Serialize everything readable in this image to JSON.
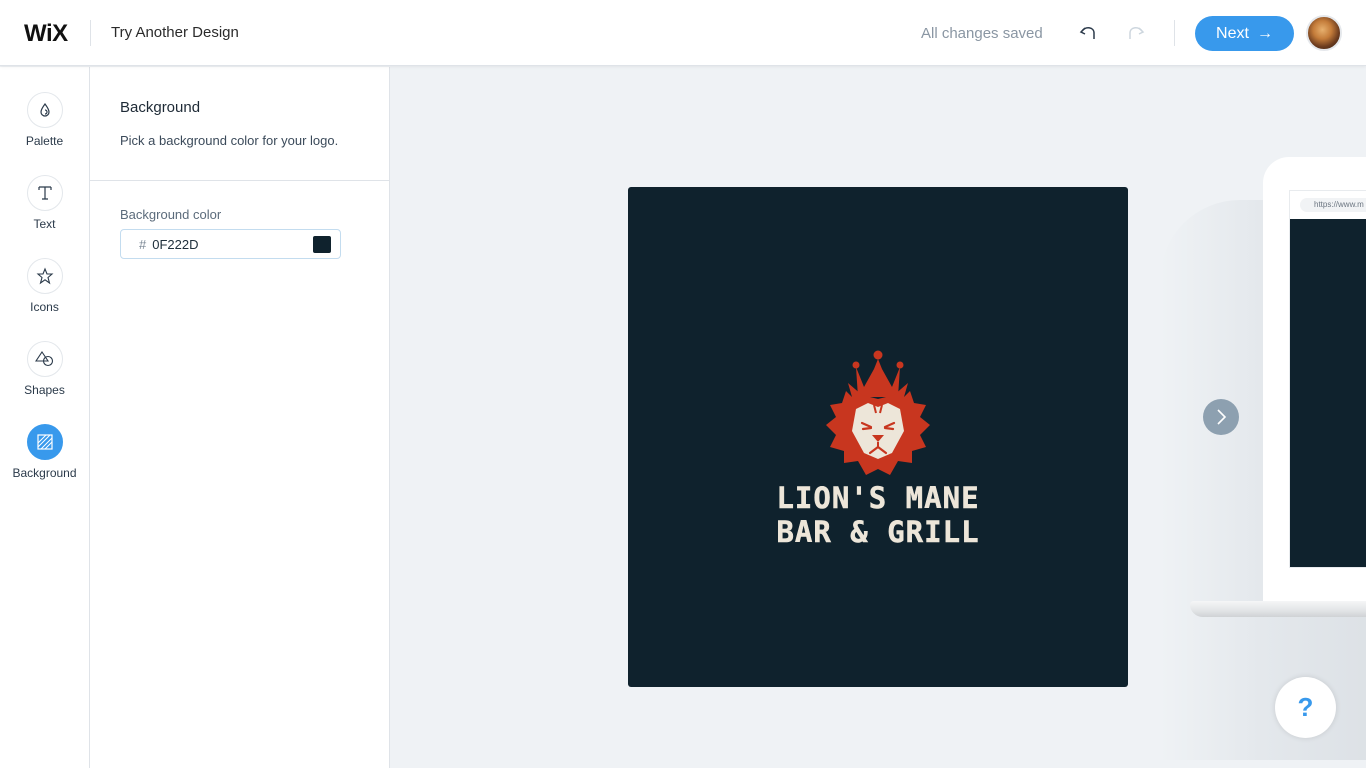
{
  "header": {
    "brand": "WiX",
    "title": "Try Another Design",
    "status": "All changes saved",
    "undo_icon": "undo-icon",
    "redo_icon": "redo-icon",
    "next_label": "Next",
    "next_arrow": "→"
  },
  "nav": {
    "items": [
      {
        "label": "Palette",
        "icon": "drop-icon",
        "active": false
      },
      {
        "label": "Text",
        "icon": "text-T-icon",
        "active": false
      },
      {
        "label": "Icons",
        "icon": "star-icon",
        "active": false
      },
      {
        "label": "Shapes",
        "icon": "shapes-icon",
        "active": false
      },
      {
        "label": "Background",
        "icon": "background-hatch-icon",
        "active": true
      }
    ]
  },
  "panel": {
    "title": "Background",
    "subtitle": "Pick a background color for your logo.",
    "field_label": "Background color",
    "hash": "#",
    "color_value": "0F222D"
  },
  "colors": {
    "accent": "#3899ec",
    "background": "#0F222D",
    "logo_red": "#c8361f",
    "logo_cream": "#ede6d9"
  },
  "logo": {
    "line1": "LION'S MANE",
    "line2": "BAR & GRILL"
  },
  "mockup": {
    "url": "https://www.m"
  },
  "help": {
    "label": "?"
  }
}
